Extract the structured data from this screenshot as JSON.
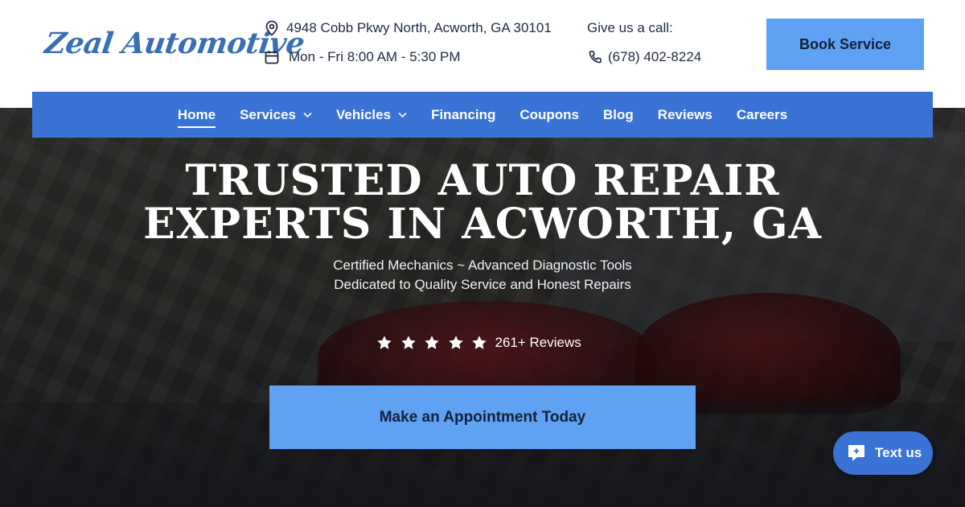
{
  "brand": {
    "logo_text": "Zeal Automotive"
  },
  "header": {
    "address": "4948 Cobb Pkwy North, Acworth, GA 30101",
    "hours": "Mon - Fri 8:00 AM - 5:30 PM",
    "call_label": "Give us a call:",
    "phone": "(678) 402-8224",
    "book_label": "Book Service"
  },
  "nav": {
    "items": [
      {
        "label": "Home",
        "active": true
      },
      {
        "label": "Services",
        "dropdown": true
      },
      {
        "label": "Vehicles",
        "dropdown": true
      },
      {
        "label": "Financing"
      },
      {
        "label": "Coupons"
      },
      {
        "label": "Blog"
      },
      {
        "label": "Reviews"
      },
      {
        "label": "Careers"
      }
    ]
  },
  "hero": {
    "headline_line1": "TRUSTED AUTO REPAIR",
    "headline_line2": "EXPERTS IN ACWORTH, GA",
    "sub1": "Certified Mechanics ~ Advanced Diagnostic Tools",
    "sub2": "Dedicated to Quality Service and Honest Repairs",
    "rating_stars": 5,
    "reviews_label": "261+ Reviews",
    "cta_label": "Make an Appointment Today"
  },
  "widget": {
    "textus_label": "Text us"
  },
  "colors": {
    "accent": "#3a72d6",
    "button": "#5fa1f2",
    "text_dark": "#1f2a44"
  },
  "icons": [
    "map-pin-icon",
    "calendar-icon",
    "phone-icon",
    "chevron-down-icon",
    "star-icon",
    "chat-icon"
  ]
}
